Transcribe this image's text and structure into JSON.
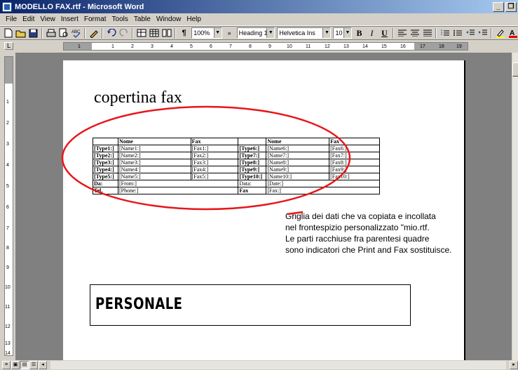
{
  "window": {
    "title": "MODELLO FAX.rtf - Microsoft Word",
    "buttons": {
      "minimize": "_",
      "restore": "❐"
    }
  },
  "menu": [
    "File",
    "Edit",
    "View",
    "Insert",
    "Format",
    "Tools",
    "Table",
    "Window",
    "Help"
  ],
  "toolbar": {
    "zoom": "100%",
    "style": "Heading 1",
    "font": "Helvetica Ins",
    "size": "10",
    "bold": "B",
    "italic": "I",
    "underline": "U"
  },
  "ruler": {
    "corner": "L",
    "numbers": [
      "1",
      "1",
      "2",
      "3",
      "4",
      "5",
      "6",
      "7",
      "8",
      "9",
      "10",
      "11",
      "12",
      "13",
      "14",
      "15",
      "16",
      "17",
      "18",
      "19"
    ],
    "vnumbers": [
      "1",
      "2",
      "3",
      "4",
      "5",
      "6",
      "7",
      "8",
      "9",
      "10",
      "11",
      "12",
      "13",
      "14"
    ]
  },
  "document": {
    "title": "copertina fax",
    "grid": {
      "header": [
        "",
        "Nome",
        "Fax",
        "",
        "Nome",
        "Fax"
      ],
      "rows": [
        [
          "[Type1:]",
          "[Name1:]",
          "[Fax1:]",
          "[Type6:]",
          "[Name6:]",
          "[Fax6:]"
        ],
        [
          "[Type2:]",
          "[Name2:]",
          "[Fax2:]",
          "[Type7:]",
          "[Name7:]",
          "[Fax7:]"
        ],
        [
          "[Type3:]",
          "[Name3:]",
          "[Fax3:]",
          "[Type8:]",
          "[Name8:]",
          "[Fax8:]"
        ],
        [
          "[Type4:]",
          "[Name4:]",
          "[Fax4:]",
          "[Type9:]",
          "[Name9:]",
          "[Fax9:]"
        ],
        [
          "[Type5:]",
          "[Name5:]",
          "[Fax5:]",
          "[Type10:]",
          "[Name10:]",
          "[Fax10:]"
        ]
      ],
      "da_label": "Da:",
      "da_value": "[From:]",
      "data_label": "Data:",
      "data_value": "[Date:]",
      "tel_label": "Tel.",
      "tel_value": "[Phone:]",
      "fax_label": "Fax",
      "fax_value": "[Fax:]"
    },
    "annotation": [
      "Griglia dei dati che va copiata e incollata",
      "nel frontespizio personalizzato \"mio.rtf.",
      "Le parti racchiuse fra parentesi quadre",
      "sono indicatori che Print and Fax sostituisce."
    ],
    "personale": "PERSONALE"
  },
  "colors": {
    "accent_oval": "#e8161b",
    "titlebar": "#0a246a"
  }
}
